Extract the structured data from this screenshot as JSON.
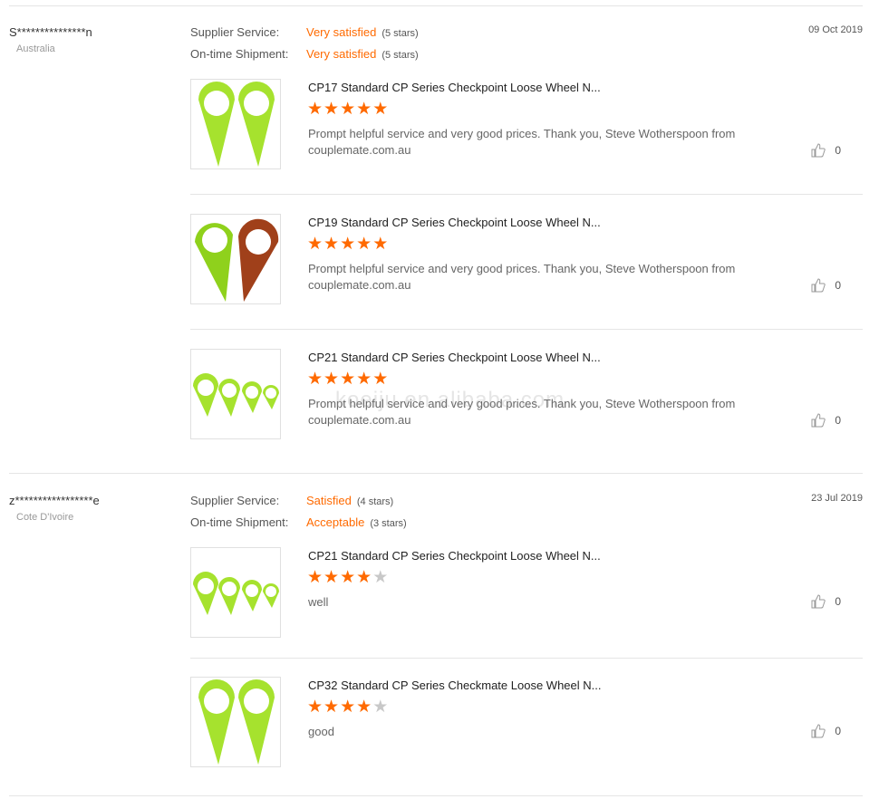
{
  "reviews": [
    {
      "buyer": "S***************n",
      "country": "Australia",
      "date": "09 Oct 2019",
      "supplier_service": {
        "label": "Supplier Service:",
        "value": "Very satisfied",
        "stars": "(5 stars)"
      },
      "ontime_shipment": {
        "label": "On-time Shipment:",
        "value": "Very satisfied",
        "stars": "(5 stars)"
      },
      "products": [
        {
          "title": "CP17 Standard CP Series Checkpoint Loose Wheel N...",
          "rating": 5,
          "comment": "Prompt helpful service and very good prices. Thank you, Steve Wotherspoon from couplemate.com.au",
          "likes": "0",
          "image": "two-green-pointers"
        },
        {
          "title": "CP19 Standard CP Series Checkpoint Loose Wheel N...",
          "rating": 5,
          "comment": "Prompt helpful service and very good prices. Thank you, Steve Wotherspoon from couplemate.com.au",
          "likes": "0",
          "image": "green-and-brown-pointers"
        },
        {
          "title": "CP21 Standard CP Series Checkpoint Loose Wheel N...",
          "rating": 5,
          "comment": "Prompt helpful service and very good prices. Thank you, Steve Wotherspoon from couplemate.com.au",
          "likes": "0",
          "image": "four-small-green-pointers"
        }
      ]
    },
    {
      "buyer": "z*****************e",
      "country": "Cote D'Ivoire",
      "date": "23 Jul 2019",
      "supplier_service": {
        "label": "Supplier Service:",
        "value": "Satisfied",
        "stars": "(4 stars)"
      },
      "ontime_shipment": {
        "label": "On-time Shipment:",
        "value": "Acceptable",
        "stars": "(3 stars)"
      },
      "products": [
        {
          "title": "CP21 Standard CP Series Checkpoint Loose Wheel N...",
          "rating": 4,
          "comment": "well",
          "likes": "0",
          "image": "four-small-green-pointers"
        },
        {
          "title": "CP32 Standard CP Series Checkmate Loose Wheel N...",
          "rating": 4,
          "comment": "good",
          "likes": "0",
          "image": "two-green-pointers"
        }
      ]
    }
  ],
  "watermark": "koeiju.en.alibaba.com",
  "colors": {
    "accent": "#ff6a00",
    "product_green": "#a6e22e",
    "product_brown": "#a0401a"
  }
}
